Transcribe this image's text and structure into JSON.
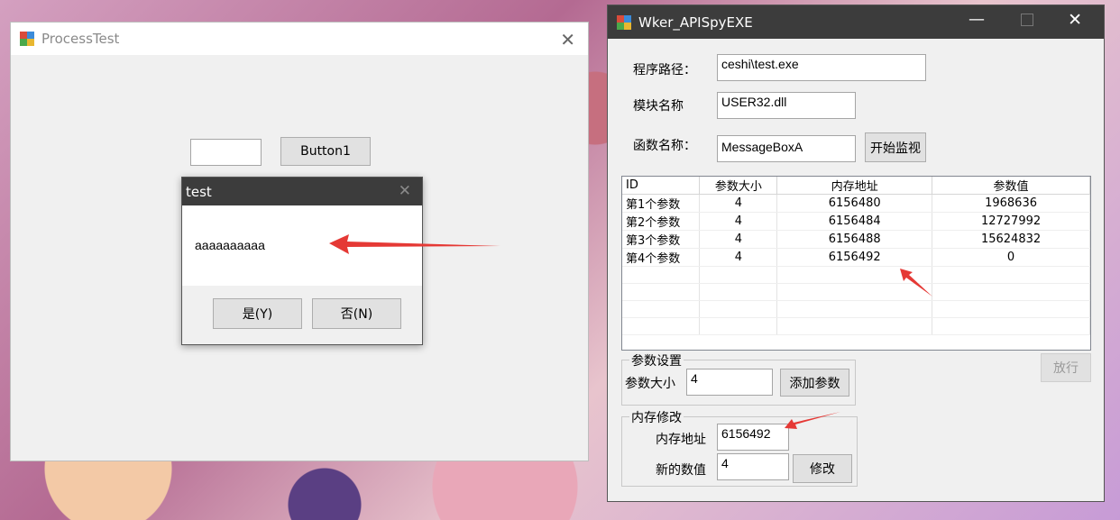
{
  "process_test": {
    "title": "ProcessTest",
    "input_value": "",
    "button1_label": "Button1"
  },
  "dialog": {
    "title": "test",
    "message": "aaaaaaaaaa",
    "yes_label": "是(Y)",
    "no_label": "否(N)"
  },
  "spy": {
    "title": "Wker_APISpyEXE",
    "path_label": "程序路径：",
    "path_value": "ceshi\\test.exe",
    "module_label": "模块名称",
    "module_value": "USER32.dll",
    "func_label": "函数名称：",
    "func_value": "MessageBoxA",
    "start_label": "开始监视",
    "columns": [
      "ID",
      "参数大小",
      "内存地址",
      "参数值"
    ],
    "rows": [
      [
        "第1个参数",
        "4",
        "6156480",
        "1968636"
      ],
      [
        "第2个参数",
        "4",
        "6156484",
        "12727992"
      ],
      [
        "第3个参数",
        "4",
        "6156488",
        "15624832"
      ],
      [
        "第4个参数",
        "4",
        "6156492",
        "0"
      ]
    ],
    "param_group_label": "参数设置",
    "param_size_label": "参数大小",
    "param_size_value": "4",
    "add_param_label": "添加参数",
    "release_label": "放行",
    "mem_group_label": "内存修改",
    "mem_addr_label": "内存地址",
    "mem_addr_value": "6156492",
    "new_value_label": "新的数值",
    "new_value_value": "4",
    "modify_label": "修改"
  },
  "colors": {
    "dark_title": "#3c3c3c",
    "arrow": "#e53935",
    "window_bg": "#f0f0f0"
  }
}
